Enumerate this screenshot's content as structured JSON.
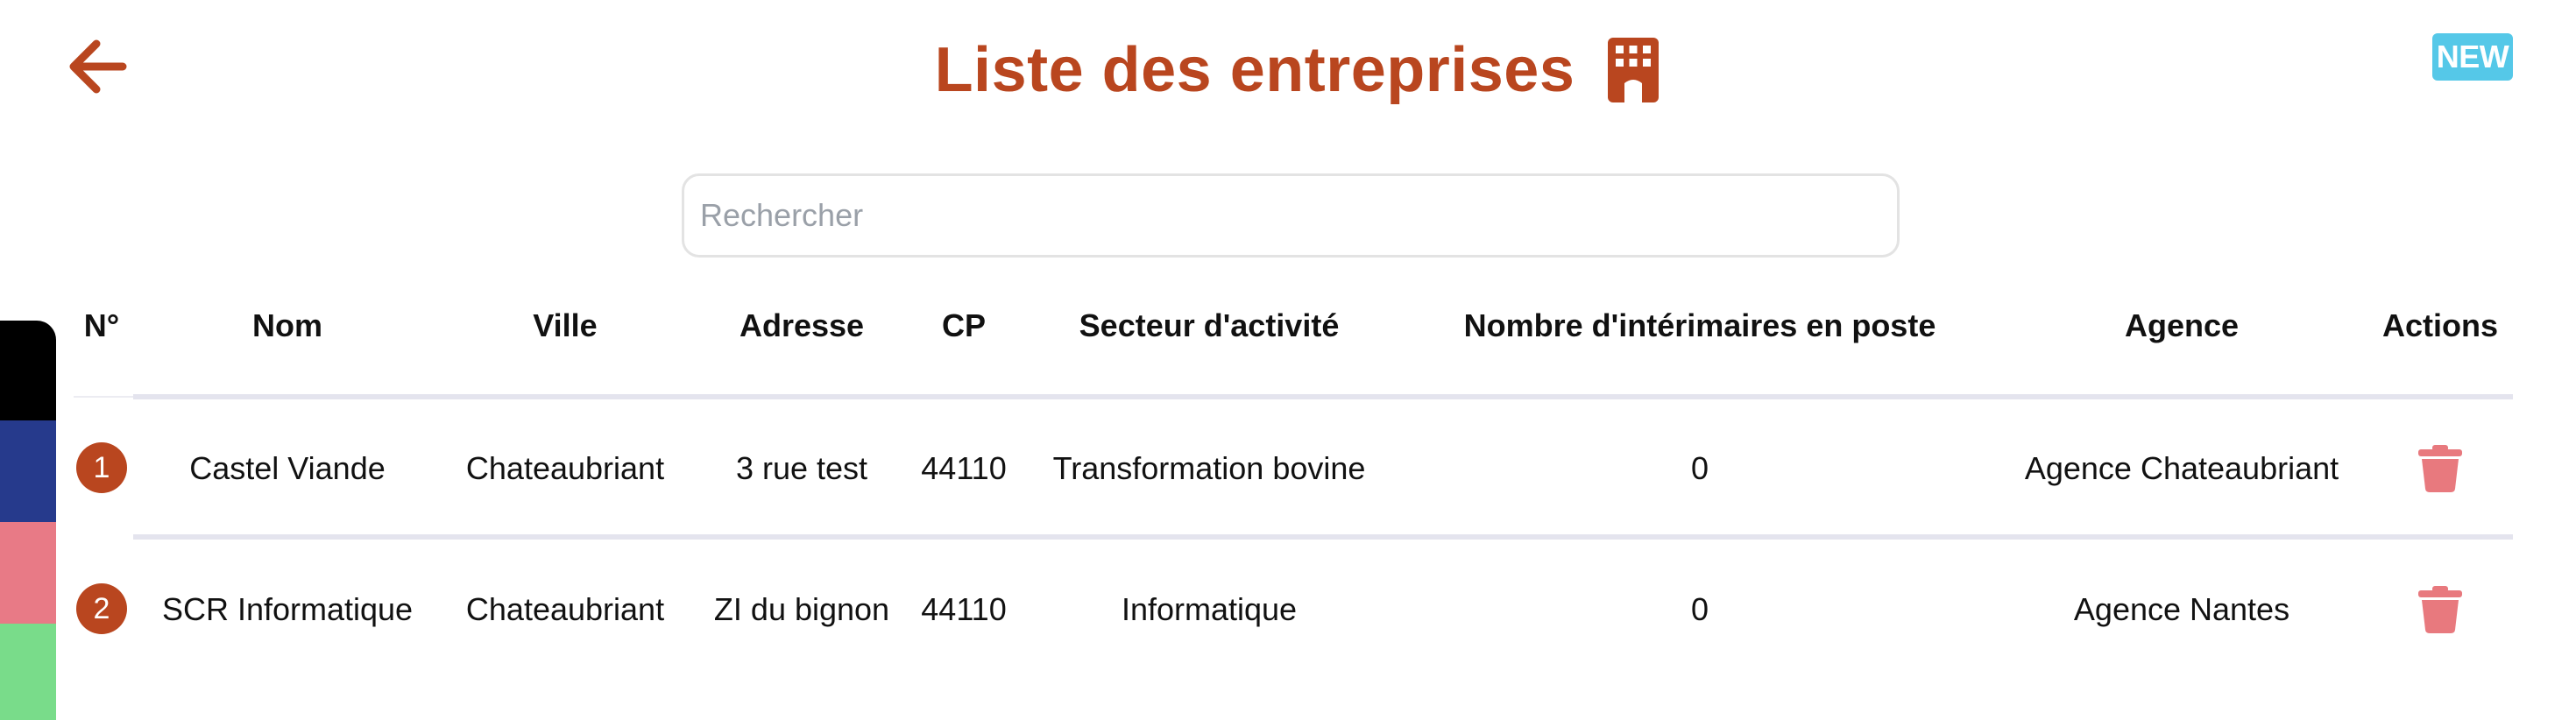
{
  "header": {
    "title": "Liste des entreprises",
    "new_badge": "NEW",
    "back_icon": "arrow-left-icon",
    "title_icon": "building-icon"
  },
  "search": {
    "placeholder": "Rechercher",
    "value": ""
  },
  "table": {
    "columns": [
      "N°",
      "Nom",
      "Ville",
      "Adresse",
      "CP",
      "Secteur d'activité",
      "Nombre d'intérimaires en poste",
      "Agence",
      "Actions"
    ],
    "rows": [
      {
        "n": "1",
        "nom": "Castel Viande",
        "ville": "Chateaubriant",
        "adresse": "3 rue test",
        "cp": "44110",
        "secteur": "Transformation bovine",
        "interimaires": "0",
        "agence": "Agence Chateaubriant",
        "action_icon": "trash-icon"
      },
      {
        "n": "2",
        "nom": "SCR Informatique",
        "ville": "Chateaubriant",
        "adresse": "ZI du bignon",
        "cp": "44110",
        "secteur": "Informatique",
        "interimaires": "0",
        "agence": "Agence Nantes",
        "action_icon": "trash-icon"
      }
    ]
  },
  "colors": {
    "accent": "#b9461f",
    "badge_new": "#55c8e8",
    "trash": "#e8797e",
    "strip": [
      "#000000",
      "#263a8c",
      "#e87a86",
      "#79dc8a"
    ]
  }
}
